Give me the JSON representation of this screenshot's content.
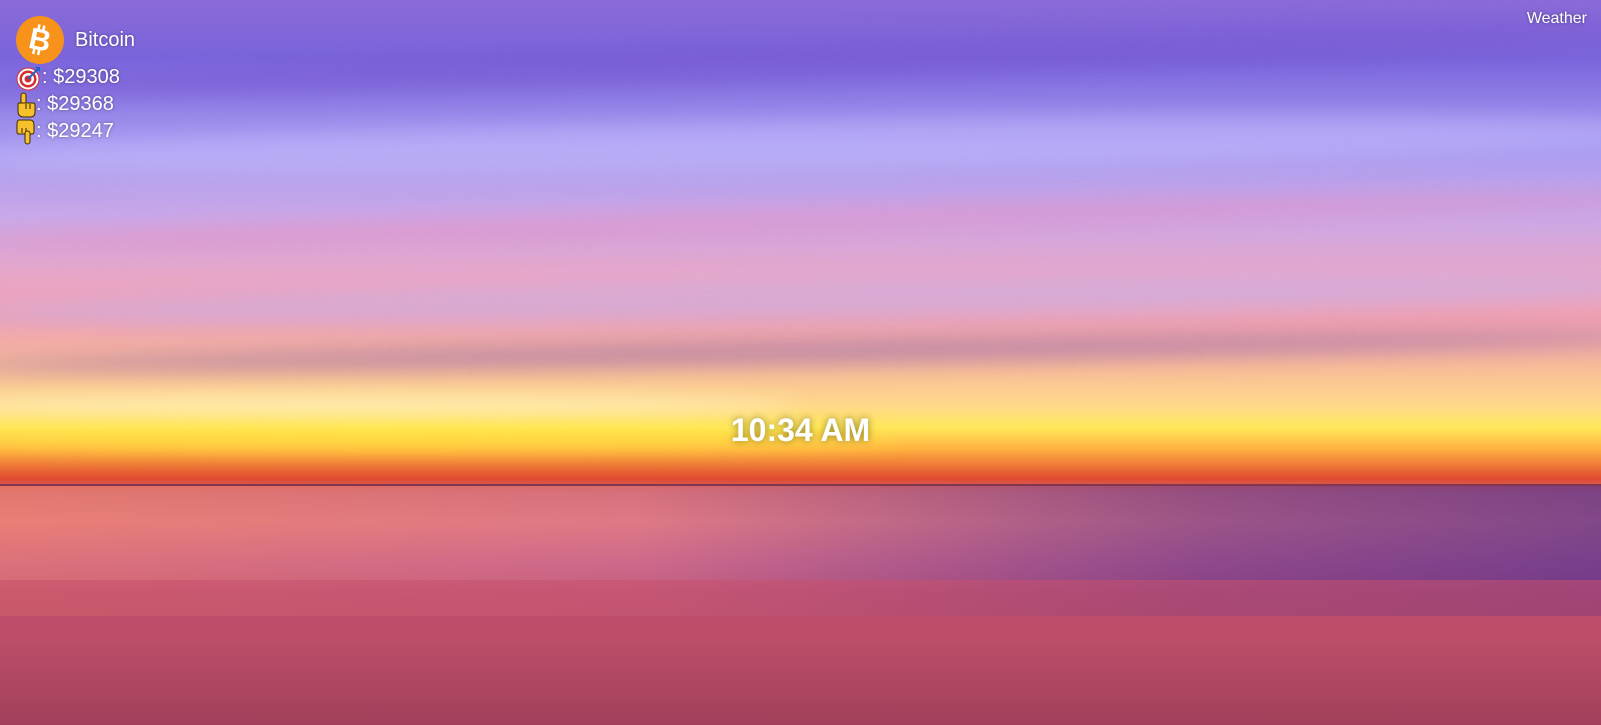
{
  "crypto": {
    "name": "Bitcoin",
    "logo_icon": "bitcoin-logo-icon",
    "brand_color": "#f7931a",
    "rows": [
      {
        "icon": "target-icon",
        "label": ": $29308"
      },
      {
        "icon": "pointing-up-icon",
        "label": ": $29368"
      },
      {
        "icon": "pointing-down-icon",
        "label": ": $29247"
      }
    ]
  },
  "clock": {
    "time": "10:34 AM"
  },
  "weather": {
    "label": "Weather"
  }
}
